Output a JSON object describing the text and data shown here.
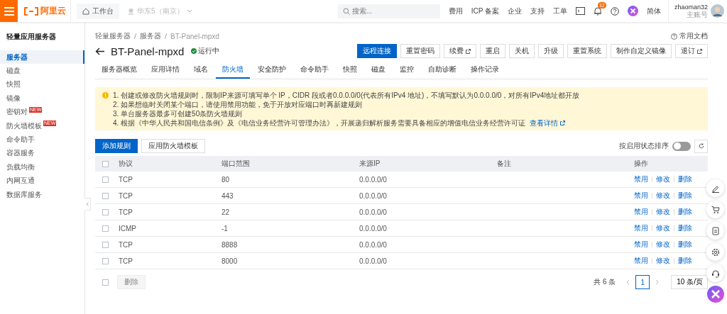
{
  "topbar": {
    "logo": "阿里云",
    "workbench": "工作台",
    "region": "华东5（南京）",
    "search": {
      "placeholder": "搜索..."
    },
    "links": [
      "费用",
      "ICP 备案",
      "企业",
      "支持",
      "工单"
    ],
    "notifications": "12",
    "language": "简体",
    "user": {
      "name": "zhaoman32",
      "role": "主账号"
    }
  },
  "sidebar": {
    "title": "轻量应用服务器",
    "items": [
      {
        "label": "服务器",
        "selected": true
      },
      {
        "label": "磁盘",
        "selected": false
      },
      {
        "label": "快照",
        "selected": false
      },
      {
        "label": "镜像",
        "selected": false
      },
      {
        "label": "密钥对",
        "selected": false,
        "badge": "NEW"
      },
      {
        "label": "防火墙模板",
        "selected": false,
        "badge": "NEW"
      },
      {
        "label": "命令助手",
        "selected": false
      },
      {
        "label": "容器服务",
        "selected": false
      },
      {
        "label": "负载均衡",
        "selected": false
      },
      {
        "label": "内网互通",
        "selected": false
      },
      {
        "label": "数据库服务",
        "selected": false
      }
    ]
  },
  "breadcrumb": [
    "轻量服务器",
    "服务器",
    "BT-Panel-mpxd"
  ],
  "help_link": "常用文档",
  "title": "BT-Panel-mpxd",
  "status": "运行中",
  "actions": [
    {
      "label": "远程连接",
      "kind": "primary",
      "external": false
    },
    {
      "label": "重置密码",
      "kind": "default",
      "external": false
    },
    {
      "label": "续费",
      "kind": "default",
      "external": true
    },
    {
      "label": "重启",
      "kind": "default",
      "external": false
    },
    {
      "label": "关机",
      "kind": "default",
      "external": false
    },
    {
      "label": "升级",
      "kind": "default",
      "external": false
    },
    {
      "label": "重置系统",
      "kind": "default",
      "external": false
    },
    {
      "label": "制作自定义镜像",
      "kind": "default",
      "external": false
    },
    {
      "label": "退订",
      "kind": "default",
      "external": true
    }
  ],
  "tabs": [
    {
      "label": "服务器概览",
      "selected": false
    },
    {
      "label": "应用详情",
      "selected": false
    },
    {
      "label": "域名",
      "selected": false
    },
    {
      "label": "防火墙",
      "selected": true
    },
    {
      "label": "安全防护",
      "selected": false
    },
    {
      "label": "命令助手",
      "selected": false
    },
    {
      "label": "快照",
      "selected": false
    },
    {
      "label": "磁盘",
      "selected": false
    },
    {
      "label": "监控",
      "selected": false
    },
    {
      "label": "自助诊断",
      "selected": false
    },
    {
      "label": "操作记录",
      "selected": false
    }
  ],
  "notice": {
    "lines": [
      "1. 创建或修改防火墙规则时，限制IP来源可填写单个 IP，CIDR 段或者0.0.0.0/0(代表所有IPv4 地址)，不填写默认为0.0.0.0/0，对所有IPv4地址都开放",
      "2. 如果想临时关闭某个端口，请使用禁用功能，免于开放对应端口时再新建规则",
      "3. 单台服务器最多可创建50条防火墙规则",
      "4. 根据《中华人民共和国电信条例》及《电信业务经营许可管理办法》，开展递归解析服务需要具备相应的增值电信业务经营许可证"
    ],
    "link": "查看详情"
  },
  "toolbar": {
    "buttons": [
      {
        "label": "添加规则",
        "kind": "primary"
      },
      {
        "label": "应用防火墙模板",
        "kind": "default"
      }
    ],
    "sort_toggle": {
      "label": "按启用状态排序",
      "on": false
    }
  },
  "table": {
    "select_all": false,
    "columns": [
      "协议",
      "端口范围",
      "来源IP",
      "备注",
      "操作"
    ],
    "rows": [
      {
        "checked": false,
        "protocol": "TCP",
        "port": "80",
        "source": "0.0.0.0/0",
        "actions": [
          "禁用",
          "修改",
          "删除"
        ]
      },
      {
        "checked": false,
        "protocol": "TCP",
        "port": "443",
        "source": "0.0.0.0/0",
        "actions": [
          "禁用",
          "修改",
          "删除"
        ]
      },
      {
        "checked": false,
        "protocol": "TCP",
        "port": "22",
        "source": "0.0.0.0/0",
        "actions": [
          "禁用",
          "修改",
          "删除"
        ]
      },
      {
        "checked": false,
        "protocol": "ICMP",
        "port": "-1",
        "source": "0.0.0.0/0",
        "actions": [
          "禁用",
          "修改",
          "删除"
        ]
      },
      {
        "checked": false,
        "protocol": "TCP",
        "port": "8888",
        "source": "0.0.0.0/0",
        "actions": [
          "禁用",
          "修改",
          "删除"
        ]
      },
      {
        "checked": false,
        "protocol": "TCP",
        "port": "8000",
        "source": "0.0.0.0/0",
        "actions": [
          "禁用",
          "修改",
          "删除"
        ]
      }
    ]
  },
  "footer": {
    "select_all": false,
    "delete": {
      "label": "删除",
      "disabled": true
    },
    "total": "共 6 条",
    "pages": [
      {
        "label": "1",
        "selected": true
      }
    ],
    "page_size": "10 条/页"
  }
}
